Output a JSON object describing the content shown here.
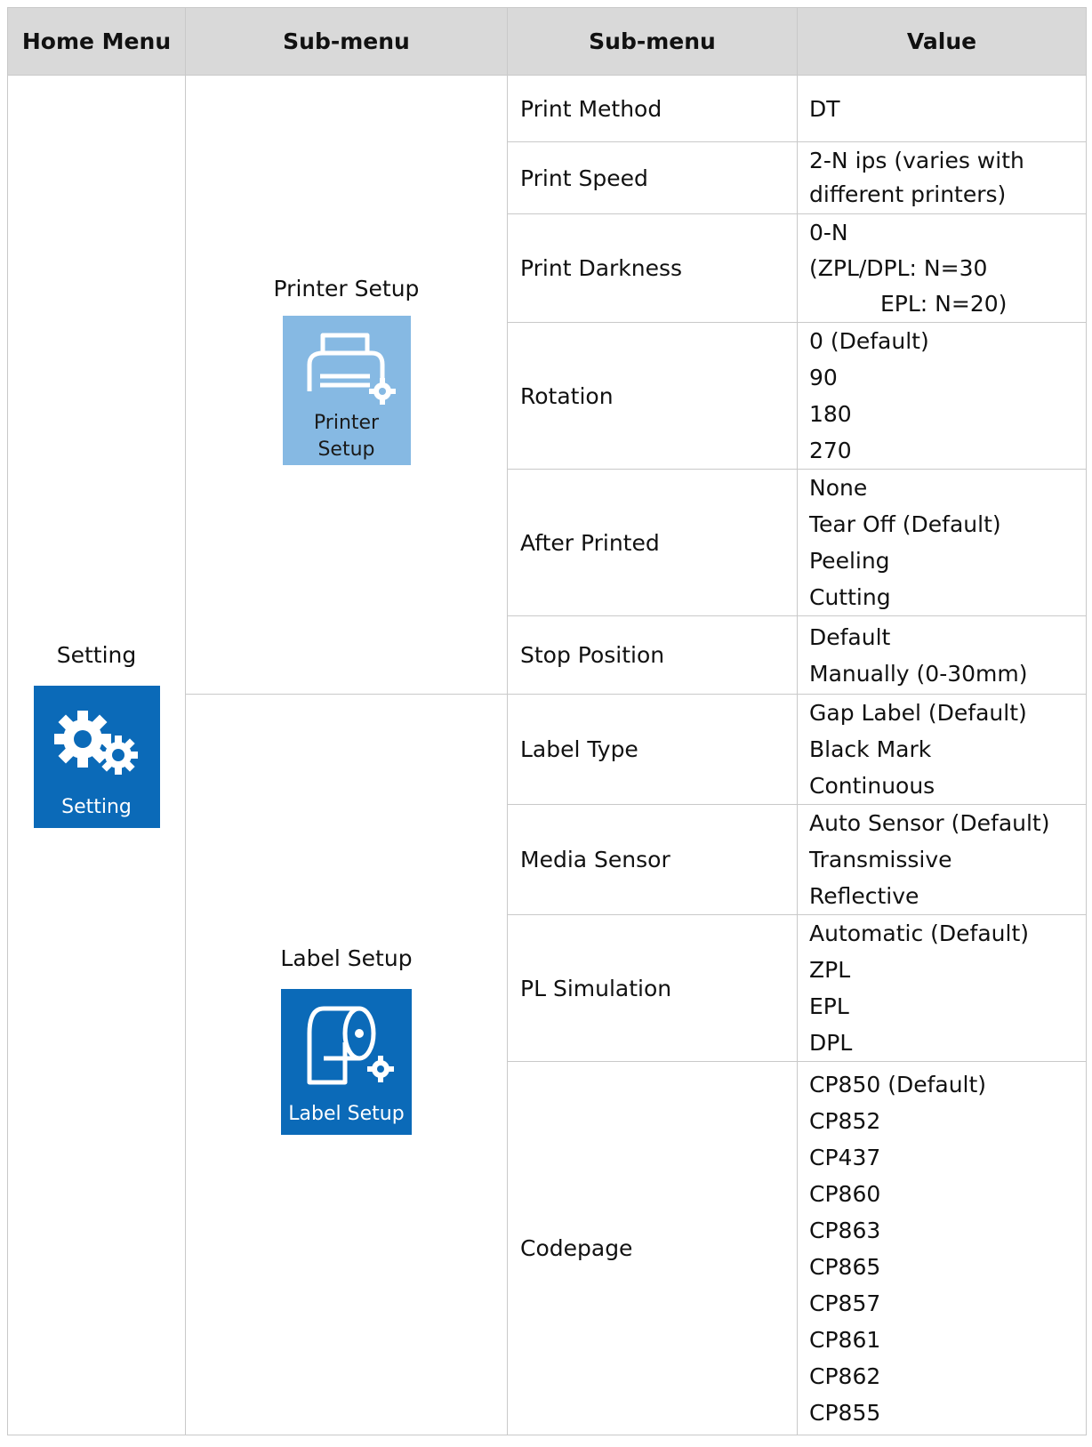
{
  "headers": [
    "Home Menu",
    "Sub-menu",
    "Sub-menu",
    "Value"
  ],
  "home_menu": {
    "label": "Setting",
    "icon": "settings-gears-icon",
    "tile_text": "Setting"
  },
  "printer_setup": {
    "label": "Printer Setup",
    "icon": "printer-settings-icon",
    "tile_text_line1": "Printer",
    "tile_text_line2": "Setup",
    "rows": [
      {
        "name": "Print Method",
        "values": [
          "DT"
        ]
      },
      {
        "name": "Print Speed",
        "values": [
          "2-N ips (varies with",
          "different printers)"
        ]
      },
      {
        "name": "Print Darkness",
        "values": [
          "0-N",
          "(ZPL/DPL: N=30",
          "EPL: N=20)"
        ]
      },
      {
        "name": "Rotation",
        "values": [
          "0 (Default)",
          "90",
          "180",
          "270"
        ]
      },
      {
        "name": "After Printed",
        "values": [
          "None",
          "Tear Off (Default)",
          "Peeling",
          "Cutting"
        ]
      },
      {
        "name": "Stop Position",
        "values": [
          "Default",
          "Manually (0-30mm)"
        ]
      }
    ]
  },
  "label_setup": {
    "label": "Label Setup",
    "icon": "label-roll-settings-icon",
    "tile_text": "Label Setup",
    "rows": [
      {
        "name": "Label Type",
        "values": [
          "Gap Label (Default)",
          "Black Mark",
          "Continuous"
        ]
      },
      {
        "name": "Media Sensor",
        "values": [
          "Auto Sensor (Default)",
          "Transmissive",
          "Reflective"
        ]
      },
      {
        "name": "PL Simulation",
        "values": [
          "Automatic (Default)",
          "ZPL",
          "EPL",
          "DPL"
        ]
      },
      {
        "name": "Codepage",
        "values": [
          "CP850 (Default)",
          "CP852",
          "CP437",
          "CP860",
          "CP863",
          "CP865",
          "CP857",
          "CP861",
          "CP862",
          "CP855"
        ]
      }
    ]
  },
  "colors": {
    "header_bg": "#d9d9d9",
    "tile_blue": "#0b6ab8",
    "tile_light_blue": "#86b9e3",
    "border": "#c9c9c9"
  }
}
